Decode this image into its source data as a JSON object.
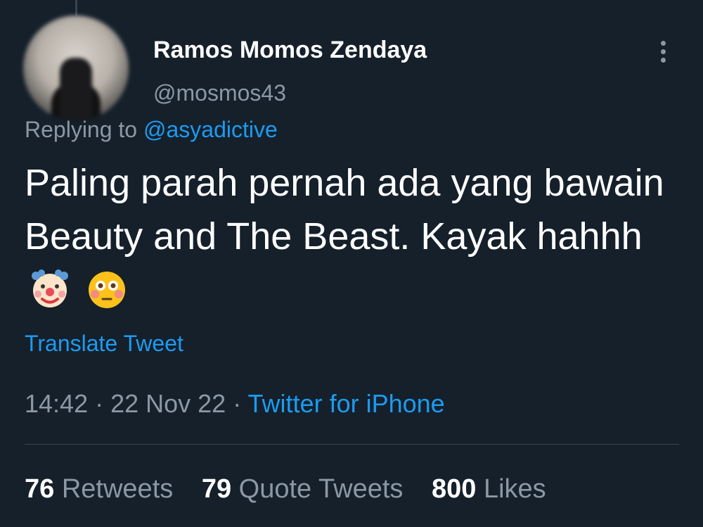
{
  "author": {
    "display_name": "Ramos Momos Zendaya",
    "handle": "@mosmos43"
  },
  "reply": {
    "prefix": "Replying to",
    "mention": "@asyadictive"
  },
  "tweet": {
    "text": "Paling parah pernah ada yang bawain Beauty and The Beast. Kayak hahhh",
    "emojis": [
      "clown-face-emoji",
      "flushed-face-emoji"
    ]
  },
  "translate_label": "Translate Tweet",
  "meta": {
    "time": "14:42",
    "sep1": " · ",
    "date": "22 Nov 22",
    "sep2": " · ",
    "source": "Twitter for iPhone"
  },
  "stats": {
    "retweets": {
      "count": "76",
      "label": "Retweets"
    },
    "quotes": {
      "count": "79",
      "label": "Quote Tweets"
    },
    "likes": {
      "count": "800",
      "label": "Likes"
    }
  },
  "colors": {
    "background": "#15202b",
    "accent": "#1d9bf0",
    "muted": "#8b98a5"
  }
}
